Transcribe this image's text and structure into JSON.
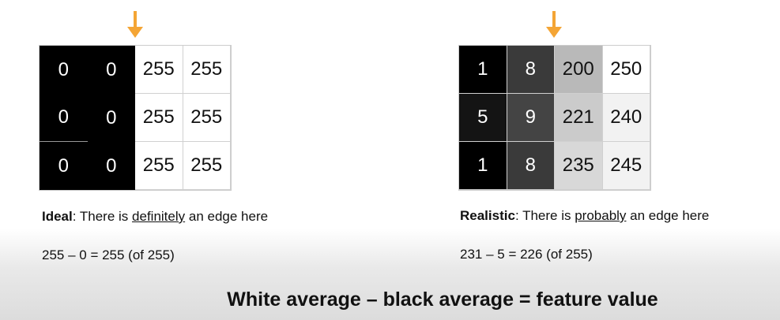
{
  "left": {
    "cells": [
      [
        "0",
        "0",
        "255",
        "255"
      ],
      [
        "0",
        "0",
        "255",
        "255"
      ],
      [
        "0",
        "0",
        "255",
        "255"
      ]
    ],
    "bg": [
      [
        "#000",
        "#000",
        "#fff",
        "#fff"
      ],
      [
        "#000",
        "#000",
        "#fff",
        "#fff"
      ],
      [
        "#000",
        "#000",
        "#fff",
        "#fff"
      ]
    ],
    "caption_bold": "Ideal",
    "caption_pre": ": There is ",
    "caption_u": "definitely",
    "caption_post": " an edge here",
    "equation": "255 – 0 = 255 (of 255)"
  },
  "right": {
    "cells": [
      [
        "1",
        "8",
        "200",
        "250"
      ],
      [
        "5",
        "9",
        "221",
        "240"
      ],
      [
        "1",
        "8",
        "235",
        "245"
      ]
    ],
    "bg": [
      [
        "#000",
        "#3a3a3a",
        "#b9b9b9",
        "#fff"
      ],
      [
        "#141414",
        "#444",
        "#cbcbcb",
        "#f2f2f2"
      ],
      [
        "#000",
        "#3a3a3a",
        "#d8d8d8",
        "#f2f2f2"
      ]
    ],
    "caption_bold": "Realistic",
    "caption_pre": ": There is ",
    "caption_u": "probably",
    "caption_post": " an edge here",
    "equation": "231 – 5 = 226 (of 255)"
  },
  "title": "White average – black average = feature value",
  "colors": {
    "arrow": "#f4a535"
  }
}
